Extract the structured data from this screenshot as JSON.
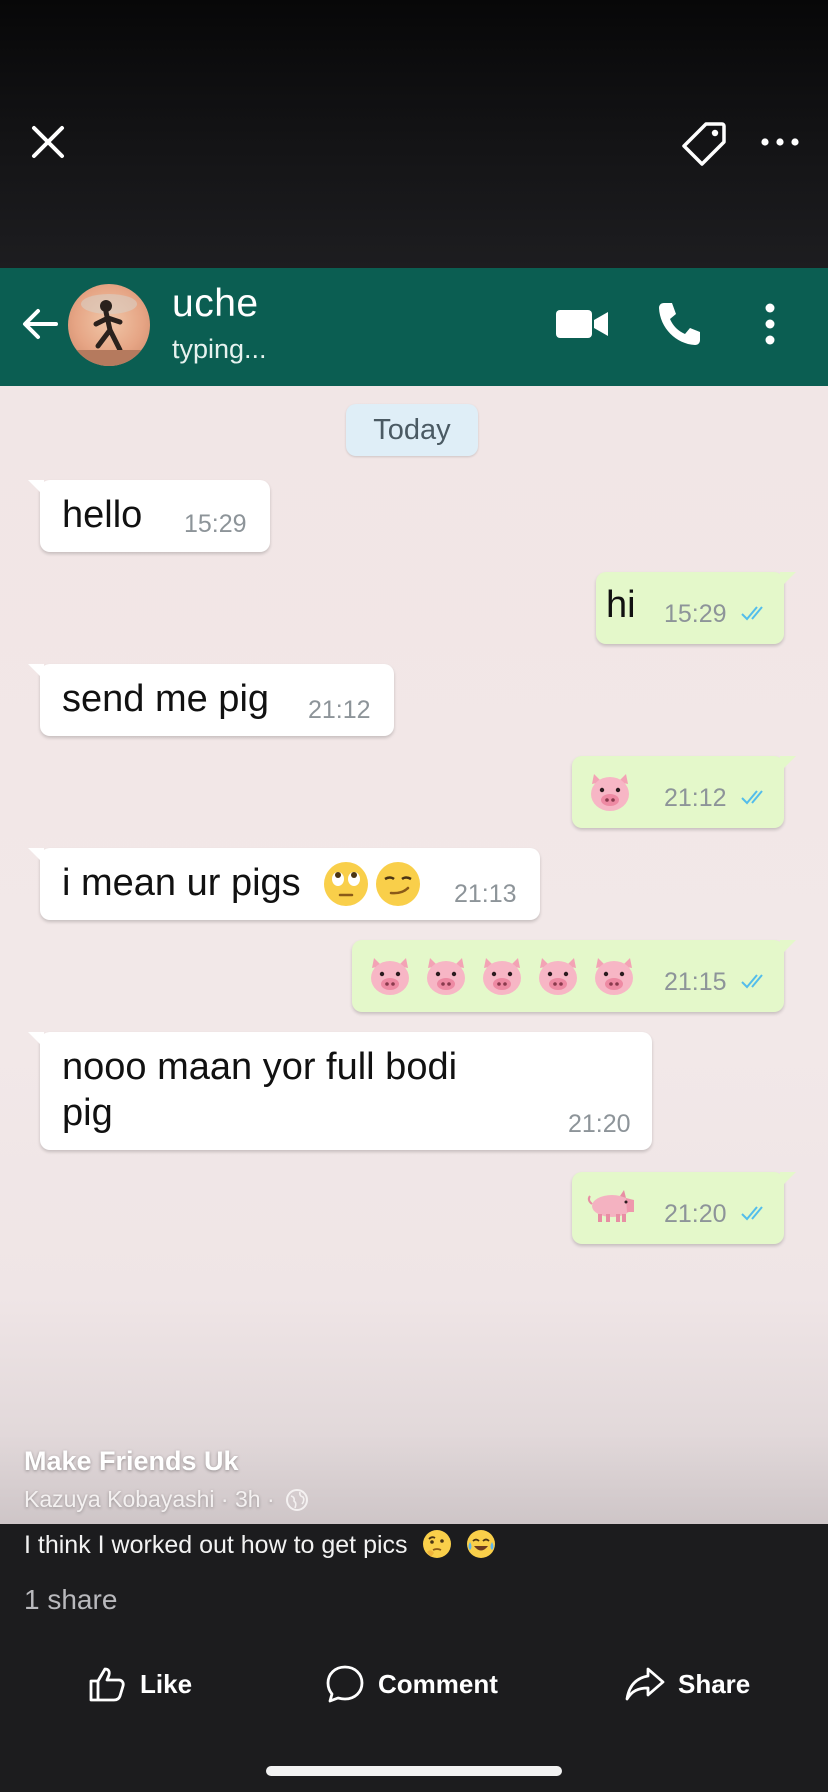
{
  "viewer": {
    "icons": [
      "close-icon",
      "tag-icon",
      "more-icon"
    ]
  },
  "chat": {
    "contact_name": "uche",
    "contact_status": "typing...",
    "date_chip": "Today",
    "messages": [
      {
        "direction": "in",
        "text": "hello",
        "time": "15:29"
      },
      {
        "direction": "out",
        "text": "hi",
        "time": "15:29",
        "read": true
      },
      {
        "direction": "in",
        "text": "send me pig",
        "time": "21:12"
      },
      {
        "direction": "out",
        "text": "",
        "emoji": [
          "pig-face"
        ],
        "time": "21:12",
        "read": true
      },
      {
        "direction": "in",
        "text": "i mean ur pigs",
        "emoji": [
          "rolling-eyes-face",
          "smirking-face"
        ],
        "time": "21:13"
      },
      {
        "direction": "out",
        "text": "",
        "emoji": [
          "pig-face",
          "pig-face",
          "pig-face",
          "pig-face",
          "pig-face"
        ],
        "time": "21:15",
        "read": true
      },
      {
        "direction": "in",
        "text": "nooo maan yor full bodi",
        "text_line2": "pig",
        "time": "21:20"
      },
      {
        "direction": "out",
        "text": "",
        "emoji": [
          "pig"
        ],
        "time": "21:20",
        "read": true
      }
    ],
    "colors": {
      "header": "#0b5e52",
      "outgoing": "#e4f8ca",
      "incoming": "#ffffff",
      "ticks": "#53bdeb"
    }
  },
  "post": {
    "page_name": "Make Friends Uk",
    "author": "Kazuya Kobayashi",
    "separator": "·",
    "age": "3h",
    "caption": "I think I worked out how to get pics",
    "caption_emoji": [
      "thinking-face",
      "tears-of-joy-face"
    ],
    "share_count": "1 share"
  },
  "actions": {
    "like": "Like",
    "comment": "Comment",
    "share": "Share"
  }
}
